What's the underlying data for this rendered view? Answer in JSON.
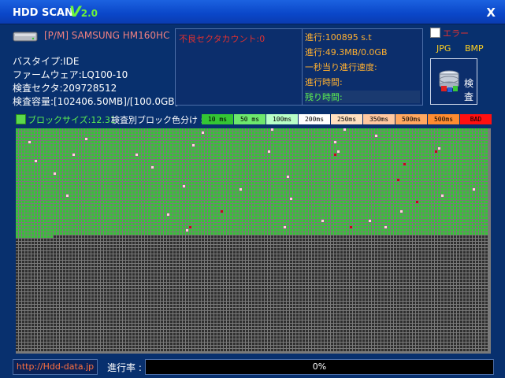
{
  "window": {
    "title": "HDD SCAN",
    "version_letter": "V",
    "version_num": "2.0",
    "close_label": "X"
  },
  "drive": {
    "name": "[P/M] SAMSUNG HM160HC",
    "bus_type": "バスタイプ:IDE",
    "firmware": "ファームウェア:LQ100-10",
    "sectors": "検査セクタ:209728512",
    "capacity": "検査容量:[102406.50MB]/[100.0GB]"
  },
  "bad_sectors": {
    "label": "不良セクタカウント:0"
  },
  "stats": {
    "progress": "進行:100895 s.t",
    "speed_now": "進行:49.3MB/0.0GB",
    "speed_per_sec": "一秒当り進行速度:",
    "elapsed": "進行時間:",
    "remaining": "残り時間:"
  },
  "options": {
    "error_label": "エラー",
    "jpg_label": "JPG",
    "bmp_label": "BMP",
    "scan_label": "検査"
  },
  "legend": {
    "block_size": "ブロックサイズ:12.31",
    "title": "検査別ブロック色分け :",
    "items": [
      {
        "label": "10 ms",
        "bg": "#34c634",
        "fg": "#000000"
      },
      {
        "label": "50 ms",
        "bg": "#6de86d",
        "fg": "#000000"
      },
      {
        "label": "100ms",
        "bg": "#b8ffc8",
        "fg": "#000000"
      },
      {
        "label": "200ms",
        "bg": "#ffffff",
        "fg": "#000000"
      },
      {
        "label": "250ms",
        "bg": "#ffe0c0",
        "fg": "#000000"
      },
      {
        "label": "350ms",
        "bg": "#ffc8a0",
        "fg": "#000000"
      },
      {
        "label": "500ms",
        "bg": "#ffa860",
        "fg": "#000000"
      },
      {
        "label": "500ms",
        "bg": "#ff8c30",
        "fg": "#000000"
      },
      {
        "label": "BAD",
        "bg": "#ff1010",
        "fg": "#000000"
      }
    ]
  },
  "scan_map": {
    "scanned_fraction": 0.48,
    "color_ok": "#34c634",
    "color_pending": "#2f2f2f",
    "color_light": "#ffd8d8",
    "color_bad": "#c01010"
  },
  "footer": {
    "link": "http://Hdd-data.jp",
    "progress_label": "進行率 :",
    "progress_text": "0%",
    "progress_value": 0
  }
}
